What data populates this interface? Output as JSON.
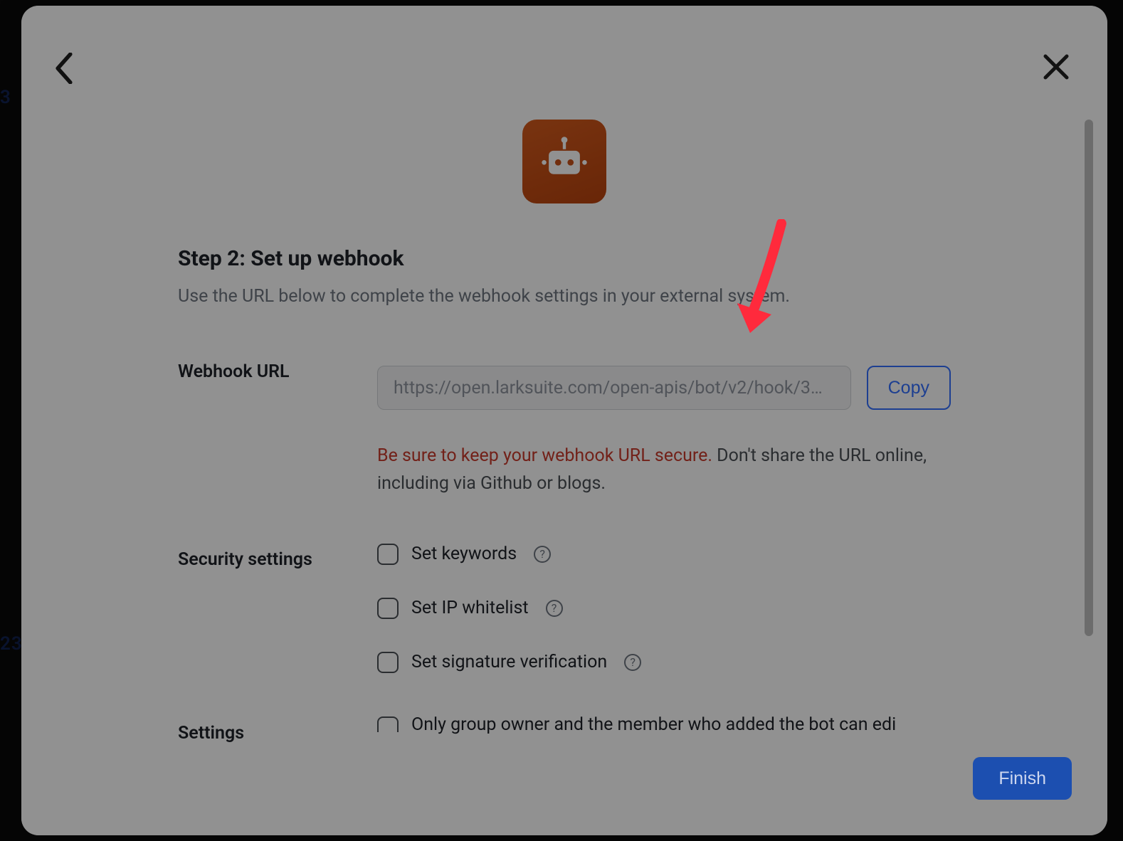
{
  "bg": {
    "hint_top": "3",
    "hint_bottom": "23"
  },
  "modal": {
    "step_title": "Step 2: Set up webhook",
    "step_description": "Use the URL below to complete the webhook settings in your external system.",
    "webhook": {
      "label": "Webhook URL",
      "value": "https://open.larksuite.com/open-apis/bot/v2/hook/3…",
      "copy_label": "Copy",
      "warning_danger": "Be sure to keep your webhook URL secure.",
      "warning_rest": " Don't share the URL online, including via Github or blogs."
    },
    "security": {
      "label": "Security settings",
      "items": [
        {
          "label": "Set keywords"
        },
        {
          "label": "Set IP whitelist"
        },
        {
          "label": "Set signature verification"
        }
      ]
    },
    "settings": {
      "label": "Settings",
      "item": "Only group owner and the member who added the bot can edi"
    },
    "finish_label": "Finish"
  },
  "icons": {
    "back": "back-icon",
    "close": "close-icon",
    "robot": "robot-icon",
    "help": "?"
  },
  "annotation": {
    "color": "#ff2a3c"
  }
}
